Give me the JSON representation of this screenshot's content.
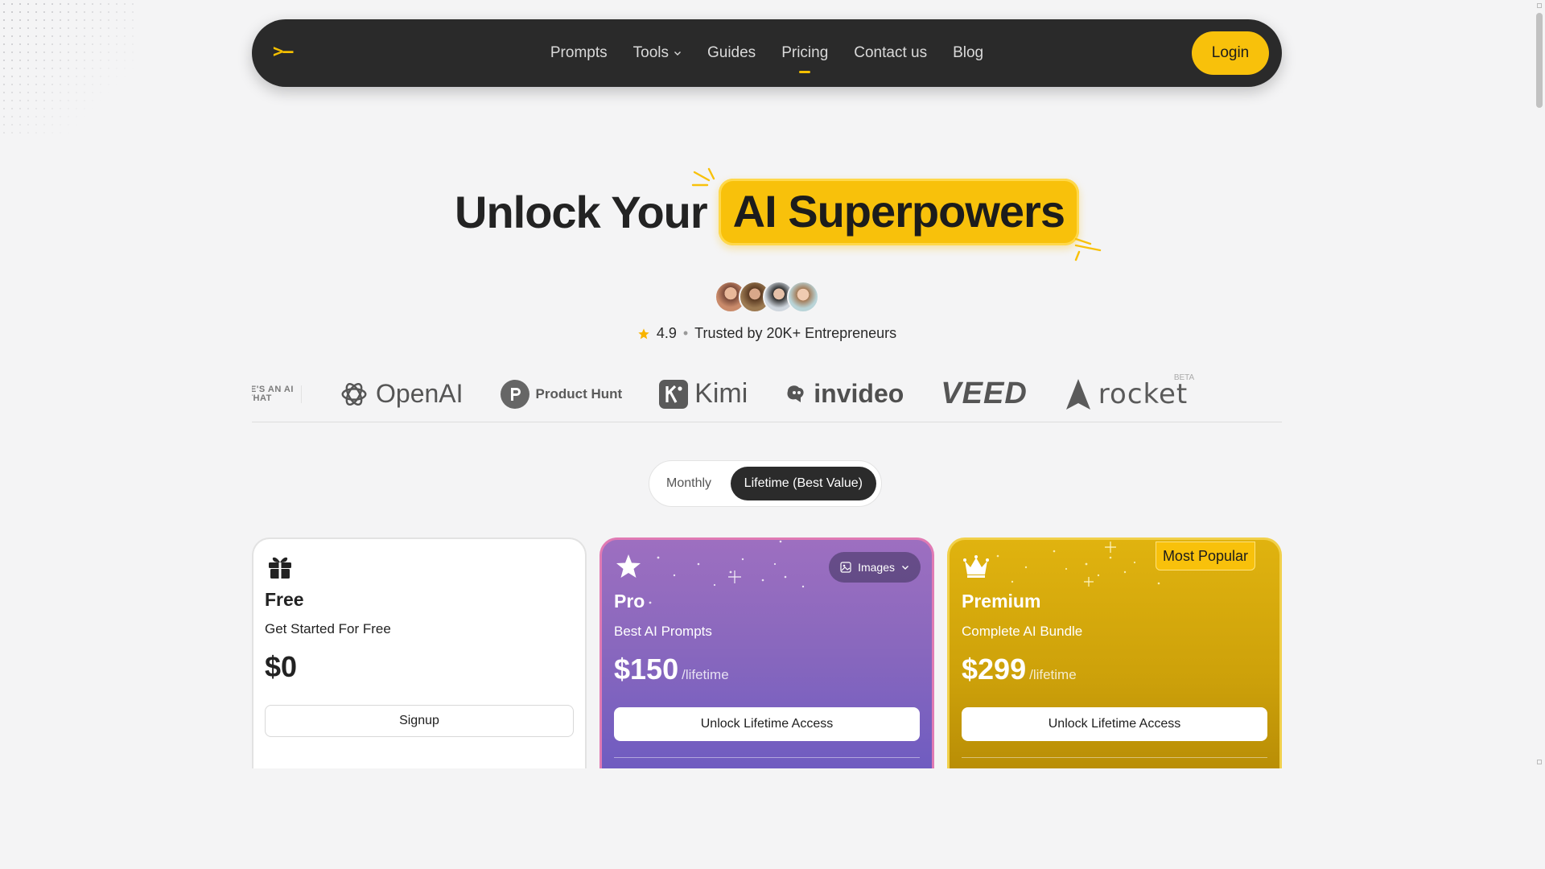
{
  "nav": {
    "logo": ">–",
    "links": [
      {
        "label": "Prompts"
      },
      {
        "label": "Tools"
      },
      {
        "label": "Guides"
      },
      {
        "label": "Pricing"
      },
      {
        "label": "Contact us"
      },
      {
        "label": "Blog"
      }
    ],
    "active": "Pricing",
    "login_label": "Login"
  },
  "hero": {
    "title_plain": "Unlock Your",
    "title_highlight": "AI Superpowers"
  },
  "rating": {
    "score": "4.9",
    "separator": "•",
    "trusted_text": "Trusted by 20K+ Entrepreneurs"
  },
  "brands": {
    "partial": "THERE'S AN AI FOR THAT",
    "openai": "OpenAI",
    "producthunt": "Product Hunt",
    "kimi": "Kimi",
    "invideo": "invideo",
    "veed": "VEED",
    "rocket": "rocket",
    "rocket_badge": "BETA"
  },
  "billing_toggle": {
    "monthly_label": "Monthly",
    "lifetime_label": "Lifetime (Best Value)",
    "selected": "Lifetime (Best Value)"
  },
  "plans": {
    "free": {
      "name": "Free",
      "subtitle": "Get Started For Free",
      "price": "$0",
      "button": "Signup"
    },
    "pro": {
      "name": "Pro",
      "subtitle": "Best AI Prompts",
      "price": "$150",
      "period": "/lifetime",
      "button": "Unlock Lifetime Access",
      "dropdown_label": "Images"
    },
    "premium": {
      "name": "Premium",
      "subtitle": "Complete AI Bundle",
      "price": "$299",
      "period": "/lifetime",
      "button": "Unlock Lifetime Access",
      "badge": "Most Popular"
    }
  },
  "colors": {
    "accent": "#f8c10b",
    "nav_bg": "#2a2a2a",
    "pro_gradient_top": "#9d6fc0",
    "premium_gradient_top": "#e0b30f"
  }
}
